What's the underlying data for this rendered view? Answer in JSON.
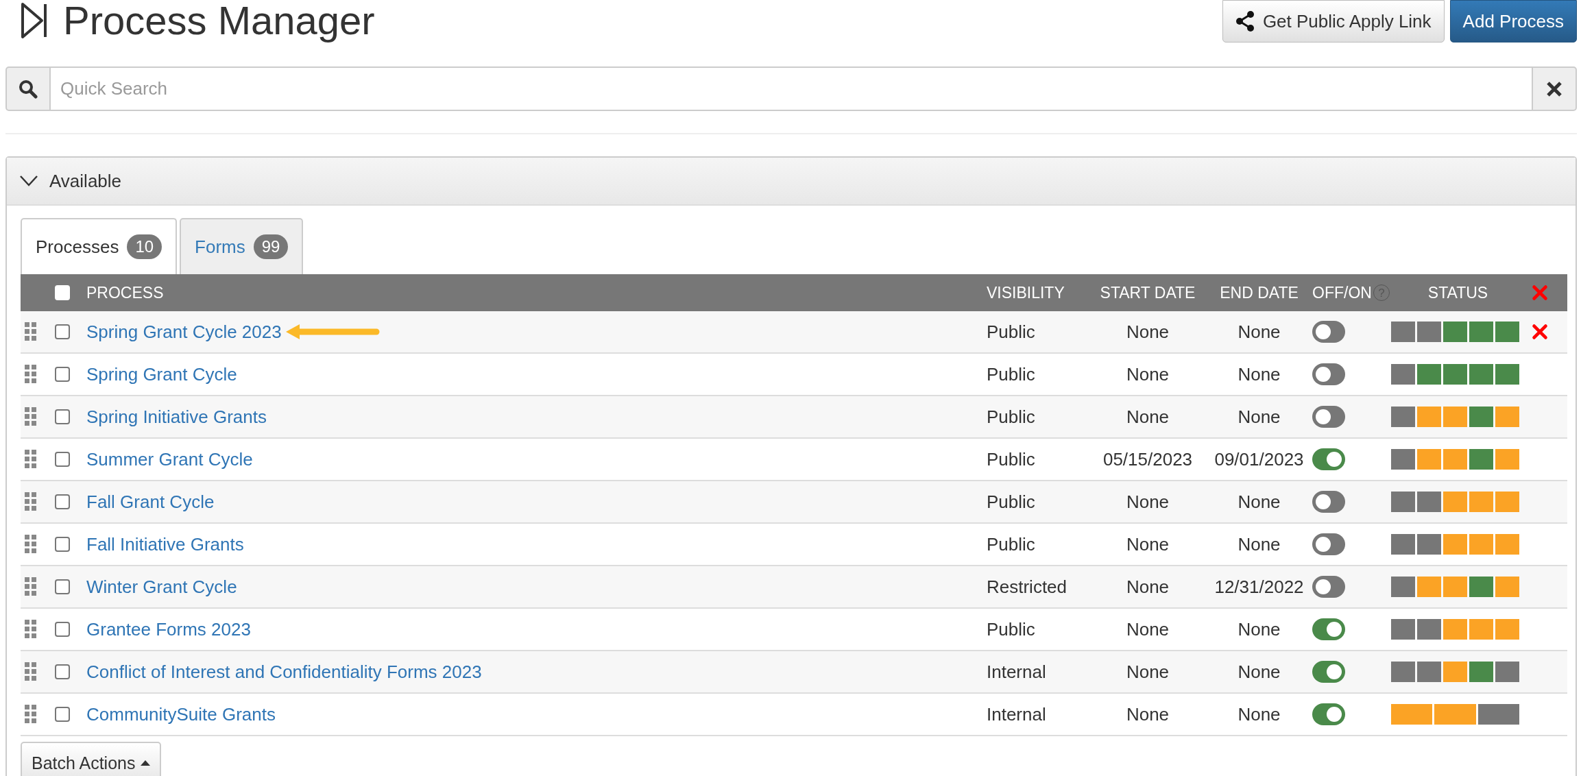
{
  "header": {
    "title": "Process Manager",
    "buttons": [
      {
        "label": "Get Public Apply Link",
        "kind": "share"
      },
      {
        "label": "Add Process",
        "kind": "primary"
      }
    ]
  },
  "search": {
    "placeholder": "Quick Search"
  },
  "panel": {
    "title": "Available",
    "expanded": true,
    "tabs": [
      {
        "label": "Processes",
        "count": "10",
        "selected": true
      },
      {
        "label": "Forms",
        "count": "99",
        "selected": false
      }
    ],
    "table": {
      "columns": [
        {
          "label": "PROCESS"
        },
        {
          "label": "VISIBILITY"
        },
        {
          "label": "START DATE"
        },
        {
          "label": "END DATE"
        },
        {
          "label": "OFF/ON",
          "help": "?"
        },
        {
          "label": "STATUS"
        }
      ],
      "header_delete": true,
      "rows": [
        {
          "process": "Spring Grant Cycle 2023",
          "visibility": "Public",
          "start_date": "None",
          "end_date": "None",
          "on": false,
          "checked": false,
          "delete": true,
          "arrow": true,
          "status": [
            {
              "color": "#777777"
            },
            {
              "color": "#777777"
            },
            {
              "color": "#4a8a4a"
            },
            {
              "color": "#4a8a4a"
            },
            {
              "color": "#4a8a4a"
            }
          ]
        },
        {
          "process": "Spring Grant Cycle",
          "visibility": "Public",
          "start_date": "None",
          "end_date": "None",
          "on": false,
          "checked": false,
          "delete": false,
          "arrow": false,
          "status": [
            {
              "color": "#777777"
            },
            {
              "color": "#4a8a4a"
            },
            {
              "color": "#4a8a4a"
            },
            {
              "color": "#4a8a4a"
            },
            {
              "color": "#4a8a4a"
            }
          ]
        },
        {
          "process": "Spring Initiative Grants",
          "visibility": "Public",
          "start_date": "None",
          "end_date": "None",
          "on": false,
          "checked": false,
          "delete": false,
          "arrow": false,
          "status": [
            {
              "color": "#777777"
            },
            {
              "color": "#fba325"
            },
            {
              "color": "#fba325"
            },
            {
              "color": "#4a8a4a"
            },
            {
              "color": "#fba325"
            }
          ]
        },
        {
          "process": "Summer Grant Cycle",
          "visibility": "Public",
          "start_date": "05/15/2023",
          "end_date": "09/01/2023",
          "on": true,
          "checked": false,
          "delete": false,
          "arrow": false,
          "status": [
            {
              "color": "#777777"
            },
            {
              "color": "#fba325"
            },
            {
              "color": "#fba325"
            },
            {
              "color": "#4a8a4a"
            },
            {
              "color": "#fba325"
            }
          ]
        },
        {
          "process": "Fall Grant Cycle",
          "visibility": "Public",
          "start_date": "None",
          "end_date": "None",
          "on": false,
          "checked": false,
          "delete": false,
          "arrow": false,
          "status": [
            {
              "color": "#777777"
            },
            {
              "color": "#777777"
            },
            {
              "color": "#fba325"
            },
            {
              "color": "#fba325"
            },
            {
              "color": "#fba325"
            }
          ]
        },
        {
          "process": "Fall Initiative Grants",
          "visibility": "Public",
          "start_date": "None",
          "end_date": "None",
          "on": false,
          "checked": false,
          "delete": false,
          "arrow": false,
          "status": [
            {
              "color": "#777777"
            },
            {
              "color": "#777777"
            },
            {
              "color": "#fba325"
            },
            {
              "color": "#fba325"
            },
            {
              "color": "#fba325"
            }
          ]
        },
        {
          "process": "Winter Grant Cycle",
          "visibility": "Restricted",
          "start_date": "None",
          "end_date": "12/31/2022",
          "on": false,
          "checked": false,
          "delete": false,
          "arrow": false,
          "status": [
            {
              "color": "#777777"
            },
            {
              "color": "#fba325"
            },
            {
              "color": "#fba325"
            },
            {
              "color": "#4a8a4a"
            },
            {
              "color": "#fba325"
            }
          ]
        },
        {
          "process": "Grantee Forms 2023",
          "visibility": "Public",
          "start_date": "None",
          "end_date": "None",
          "on": true,
          "checked": false,
          "delete": false,
          "arrow": false,
          "status": [
            {
              "color": "#777777"
            },
            {
              "color": "#777777"
            },
            {
              "color": "#fba325"
            },
            {
              "color": "#fba325"
            },
            {
              "color": "#fba325"
            }
          ]
        },
        {
          "process": "Conflict of Interest and Confidentiality Forms 2023",
          "visibility": "Internal",
          "start_date": "None",
          "end_date": "None",
          "on": true,
          "checked": false,
          "delete": false,
          "arrow": false,
          "status": [
            {
              "color": "#777777"
            },
            {
              "color": "#777777"
            },
            {
              "color": "#fba325"
            },
            {
              "color": "#4a8a4a"
            },
            {
              "color": "#777777"
            }
          ]
        },
        {
          "process": "CommunitySuite Grants",
          "visibility": "Internal",
          "start_date": "None",
          "end_date": "None",
          "on": true,
          "checked": false,
          "delete": false,
          "arrow": false,
          "status": [
            {
              "color": "#fba325"
            },
            {
              "color": "#fba325"
            },
            {
              "color": "#777777"
            }
          ]
        }
      ],
      "header_checked": false
    },
    "batch_button": "Batch Actions"
  }
}
